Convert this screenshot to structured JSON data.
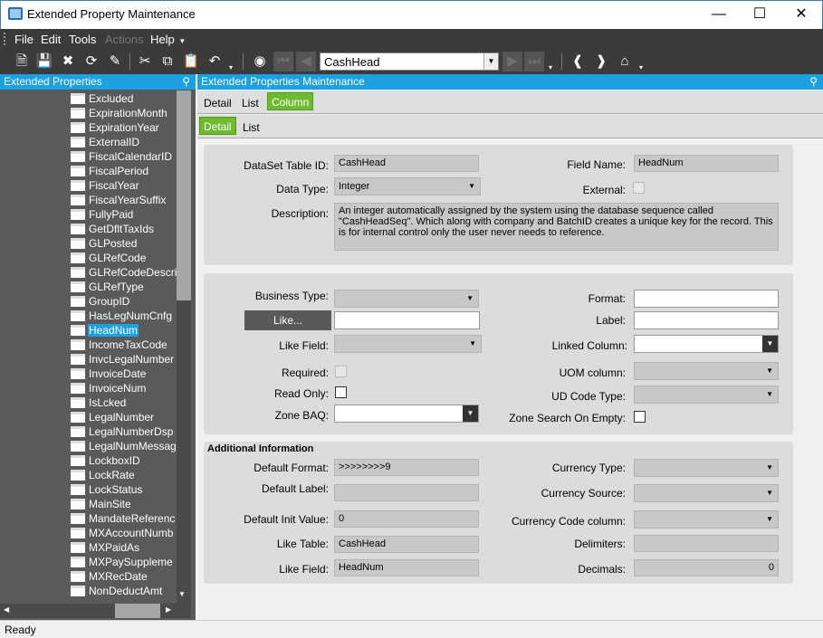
{
  "window": {
    "title": "Extended Property Maintenance"
  },
  "menu": [
    "File",
    "Edit",
    "Tools",
    "Actions",
    "Help"
  ],
  "toolbar": {
    "combo_value": "CashHead"
  },
  "left_pane": {
    "title": "Extended Properties",
    "items": [
      "Excluded",
      "ExpirationMonth",
      "ExpirationYear",
      "ExternalID",
      "FiscalCalendarID",
      "FiscalPeriod",
      "FiscalYear",
      "FiscalYearSuffix",
      "FullyPaid",
      "GetDfltTaxIds",
      "GLPosted",
      "GLRefCode",
      "GLRefCodeDescri",
      "GLRefType",
      "GroupID",
      "HasLegNumCnfg",
      "HeadNum",
      "IncomeTaxCode",
      "InvcLegalNumber",
      "InvoiceDate",
      "InvoiceNum",
      "IsLcked",
      "LegalNumber",
      "LegalNumberDsp",
      "LegalNumMessag",
      "LockboxID",
      "LockRate",
      "LockStatus",
      "MainSite",
      "MandateReferenc",
      "MXAccountNumb",
      "MXPaidAs",
      "MXPaySuppleme",
      "MXRecDate",
      "NonDeductAmt"
    ],
    "selected": "HeadNum"
  },
  "right_pane": {
    "title": "Extended Properties Maintenance",
    "tabs": [
      "Detail",
      "List",
      "Column"
    ],
    "subtabs": [
      "Detail",
      "List"
    ]
  },
  "detail": {
    "dataset_table_id_label": "DataSet Table ID:",
    "dataset_table_id": "CashHead",
    "field_name_label": "Field Name:",
    "field_name": "HeadNum",
    "data_type_label": "Data Type:",
    "data_type": "Integer",
    "external_label": "External:",
    "description_label": "Description:",
    "description": "An integer automatically assigned by the system using the database sequence called \"CashHeadSeq\". Which along with company and BatchID creates a unique key for the record. This is for internal control only the user never needs to reference."
  },
  "props": {
    "business_type_label": "Business Type:",
    "like_button": "Like...",
    "like_field_label": "Like Field:",
    "required_label": "Required:",
    "read_only_label": "Read Only:",
    "zone_baq_label": "Zone BAQ:",
    "format_label": "Format:",
    "label_label": "Label:",
    "linked_column_label": "Linked Column:",
    "uom_column_label": "UOM column:",
    "ud_code_type_label": "UD Code Type:",
    "zone_search_label": "Zone Search On Empty:"
  },
  "additional": {
    "title": "Additional Information",
    "default_format_label": "Default Format:",
    "default_format": ">>>>>>>>9",
    "default_label_label": "Default Label:",
    "default_label": "",
    "default_init_value_label": "Default Init Value:",
    "default_init_value": "0",
    "like_table_label": "Like Table:",
    "like_table": "CashHead",
    "like_field_label": "Like Field:",
    "like_field": "HeadNum",
    "currency_type_label": "Currency Type:",
    "currency_source_label": "Currency Source:",
    "currency_code_column_label": "Currency Code column:",
    "delimiters_label": "Delimiters:",
    "decimals_label": "Decimals:",
    "decimals": "0"
  },
  "status": {
    "text": "Ready"
  }
}
